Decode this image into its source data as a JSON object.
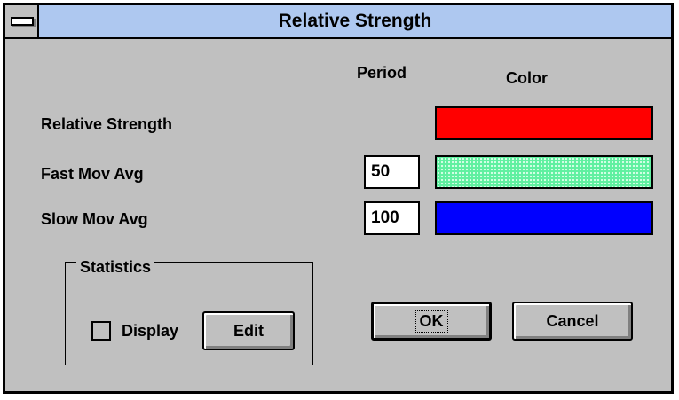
{
  "window": {
    "title": "Relative Strength"
  },
  "columns": {
    "period": "Period",
    "color": "Color"
  },
  "rows": [
    {
      "label": "Relative Strength",
      "period": null,
      "color": "#ff0000"
    },
    {
      "label": "Fast Mov Avg",
      "period": "50",
      "color": "#5ff0a0"
    },
    {
      "label": "Slow Mov Avg",
      "period": "100",
      "color": "#0000ff"
    }
  ],
  "statistics": {
    "group_label": "Statistics",
    "display_label": "Display",
    "display_checked": false,
    "edit_label": "Edit"
  },
  "buttons": {
    "ok_label": "OK",
    "cancel_label": "Cancel"
  }
}
